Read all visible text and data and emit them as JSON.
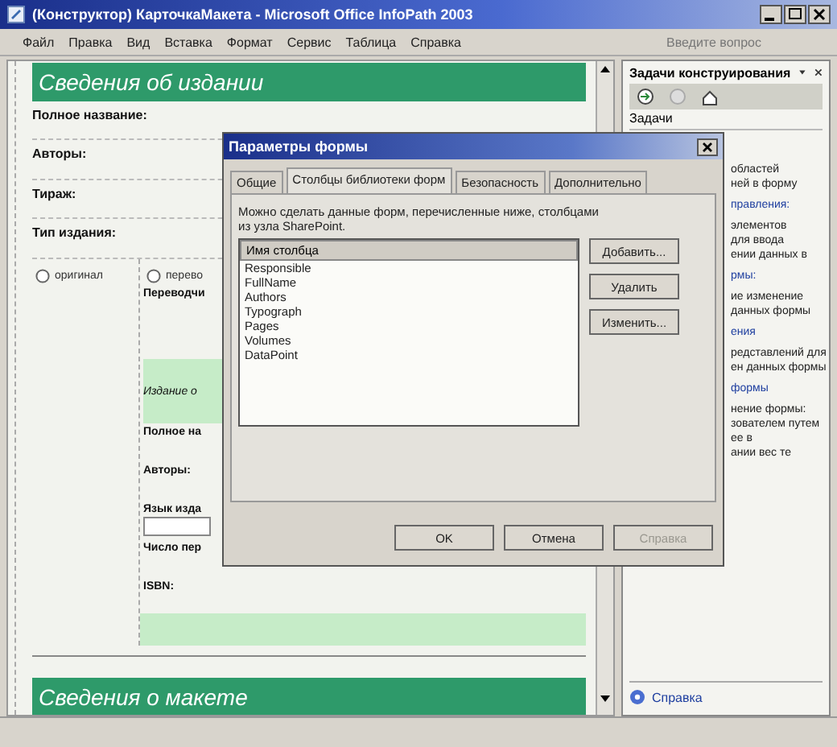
{
  "window": {
    "title": "(Конструктор) КарточкаМакета - Microsoft Office InfoPath 2003"
  },
  "menu": [
    "Файл",
    "Правка",
    "Вид",
    "Вставка",
    "Формат",
    "Сервис",
    "Таблица",
    "Справка"
  ],
  "help_box": {
    "placeholder": "Введите вопрос"
  },
  "form": {
    "header": "Сведения об издании",
    "fields": [
      {
        "label": "Полное название:"
      },
      {
        "label": "Авторы:"
      },
      {
        "label": "Тираж:"
      },
      {
        "label": "Тип издания:"
      }
    ],
    "options": [
      {
        "label": "оригинал",
        "selected": false
      },
      {
        "label": "перево",
        "selected": false
      }
    ],
    "translation_fields": [
      {
        "label": "Переводчи",
        "kind": "label"
      },
      {
        "label": "Издание о",
        "kind": "heading"
      },
      {
        "label": "Полное на",
        "kind": "label"
      },
      {
        "label": "Авторы:",
        "kind": "label"
      },
      {
        "label": "Язык изда",
        "kind": "field"
      },
      {
        "label": "Число пер",
        "kind": "label"
      },
      {
        "label": "ISBN:",
        "kind": "label"
      }
    ],
    "footer_header": "Сведения о макете"
  },
  "task_pane": {
    "title": "Задачи конструирования",
    "section": "Задачи",
    "lines": [
      {
        "text": "областей",
        "kind": "text"
      },
      {
        "text": "ней в форму",
        "kind": "text"
      },
      {
        "text": "правления:",
        "kind": "link"
      },
      {
        "text": "элементов",
        "kind": "text"
      },
      {
        "text": "для ввода",
        "kind": "text"
      },
      {
        "text": "ении данных в",
        "kind": "text"
      },
      {
        "text": "рмы:",
        "kind": "link"
      },
      {
        "text": "ие изменение",
        "kind": "text"
      },
      {
        "text": "данных формы",
        "kind": "text"
      },
      {
        "text": "ения",
        "kind": "link"
      },
      {
        "text": "редставлений для",
        "kind": "text"
      },
      {
        "text": "ен данных формы",
        "kind": "text"
      },
      {
        "text": "формы",
        "kind": "link"
      },
      {
        "text": "нение формы:",
        "kind": "text"
      },
      {
        "text": "зователем путем",
        "kind": "text"
      },
      {
        "text": "ее в",
        "kind": "text"
      },
      {
        "text": "ании вес те",
        "kind": "text"
      }
    ],
    "help_link": "Справка"
  },
  "dialog": {
    "title": "Параметры формы",
    "tabs": [
      {
        "label": "Общие",
        "selected": false
      },
      {
        "label": "Столбцы библиотеки форм",
        "selected": true
      },
      {
        "label": "Безопасность",
        "selected": false
      },
      {
        "label": "Дополнительно",
        "selected": false
      }
    ],
    "description": "Можно сделать данные форм, перечисленные ниже, столбцами из узла SharePoint.",
    "list": {
      "header": "Имя столбца",
      "items": [
        "Responsible",
        "FullName",
        "Authors",
        "Typograph",
        "Pages",
        "Volumes",
        "DataPoint"
      ]
    },
    "side_buttons": [
      {
        "label": "Добавить...",
        "disabled": false
      },
      {
        "label": "Удалить",
        "disabled": false
      },
      {
        "label": "Изменить...",
        "disabled": false
      }
    ],
    "buttons": [
      {
        "label": "OK",
        "disabled": false
      },
      {
        "label": "Отмена",
        "disabled": false
      },
      {
        "label": "Справка",
        "disabled": true
      }
    ]
  }
}
